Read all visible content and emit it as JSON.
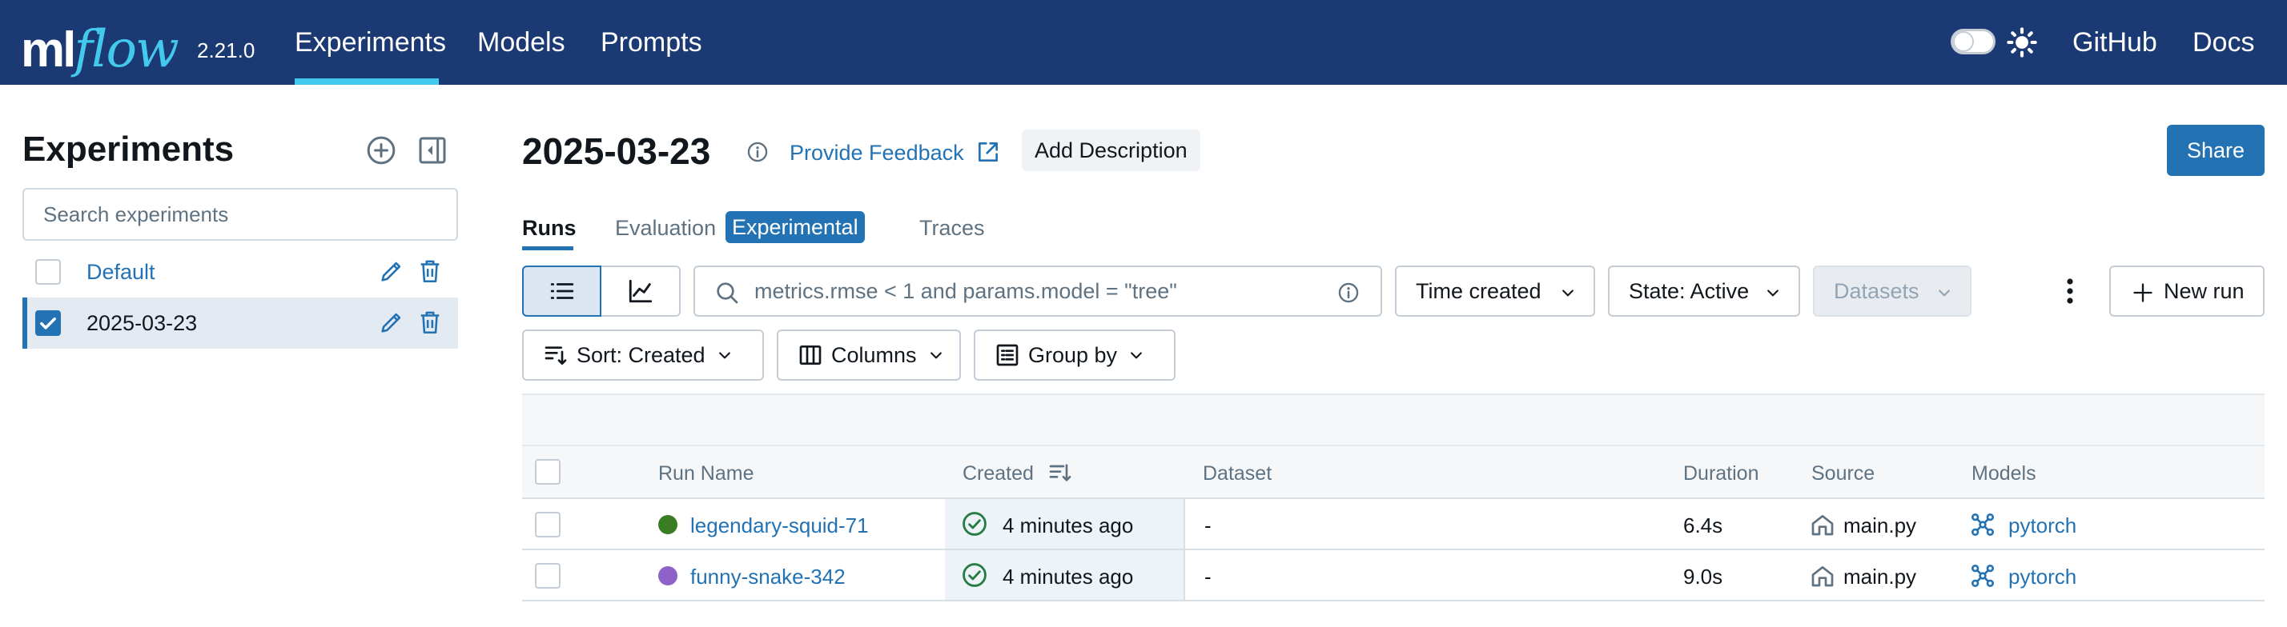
{
  "app": {
    "logo_ml": "ml",
    "logo_flow": "flow",
    "version": "2.21.0",
    "nav": [
      "Experiments",
      "Models",
      "Prompts"
    ],
    "right_links": [
      "GitHub",
      "Docs"
    ]
  },
  "sidebar": {
    "title": "Experiments",
    "search_placeholder": "Search experiments",
    "experiments": [
      {
        "name": "Default",
        "selected": false
      },
      {
        "name": "2025-03-23",
        "selected": true
      }
    ]
  },
  "experiment": {
    "title": "2025-03-23",
    "feedback_label": "Provide Feedback",
    "add_description_label": "Add Description",
    "share_label": "Share"
  },
  "tabs": {
    "runs": "Runs",
    "evaluation": "Evaluation",
    "evaluation_badge": "Experimental",
    "traces": "Traces"
  },
  "toolbar": {
    "filter_placeholder": "metrics.rmse < 1 and params.model = \"tree\"",
    "time_created": "Time created",
    "state": "State: Active",
    "datasets": "Datasets",
    "new_run": "New run",
    "sort": "Sort: Created",
    "columns": "Columns",
    "group_by": "Group by"
  },
  "table": {
    "columns": [
      "Run Name",
      "Created",
      "Dataset",
      "Duration",
      "Source",
      "Models"
    ],
    "rows": [
      {
        "name": "legendary-squid-71",
        "color": "#3b7d23",
        "created": "4 minutes ago",
        "dataset": "-",
        "duration": "6.4s",
        "source": "main.py",
        "model": "pytorch"
      },
      {
        "name": "funny-snake-342",
        "color": "#8e63c9",
        "created": "4 minutes ago",
        "dataset": "-",
        "duration": "9.0s",
        "source": "main.py",
        "model": "pytorch"
      }
    ]
  },
  "colors": {
    "header_bg": "#1b3a73",
    "accent": "#2272b4",
    "logo_accent": "#43c9ed",
    "success": "#277c43"
  }
}
